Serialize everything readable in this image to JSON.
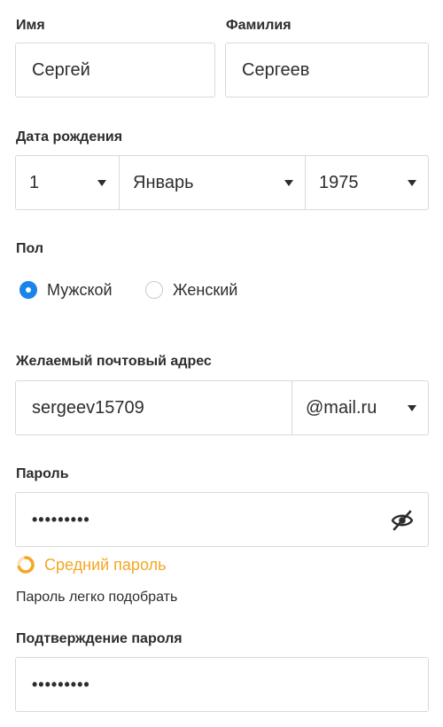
{
  "first_name": {
    "label": "Имя",
    "value": "Сергей"
  },
  "last_name": {
    "label": "Фамилия",
    "value": "Сергеев"
  },
  "birth_date": {
    "label": "Дата рождения",
    "day": "1",
    "month": "Январь",
    "year": "1975"
  },
  "gender": {
    "label": "Пол",
    "options": [
      {
        "label": "Мужской",
        "selected": true
      },
      {
        "label": "Женский",
        "selected": false
      }
    ]
  },
  "email": {
    "label": "Желаемый почтовый адрес",
    "value": "sergeev15709",
    "domain": "@mail.ru"
  },
  "password": {
    "label": "Пароль",
    "value": "•••••••••",
    "strength_text": "Средний пароль",
    "strength_color": "#f5a623",
    "strength_level": 0.5,
    "hint": "Пароль легко подобрать"
  },
  "confirm_password": {
    "label": "Подтверждение пароля",
    "value": "•••••••••"
  },
  "icons": {
    "dropdown": "caret-down-icon",
    "visibility": "eye-off-icon",
    "strength": "spinner-icon"
  },
  "colors": {
    "accent": "#1a84e8",
    "border": "#d8d9dc",
    "text": "#2c2d2e"
  }
}
